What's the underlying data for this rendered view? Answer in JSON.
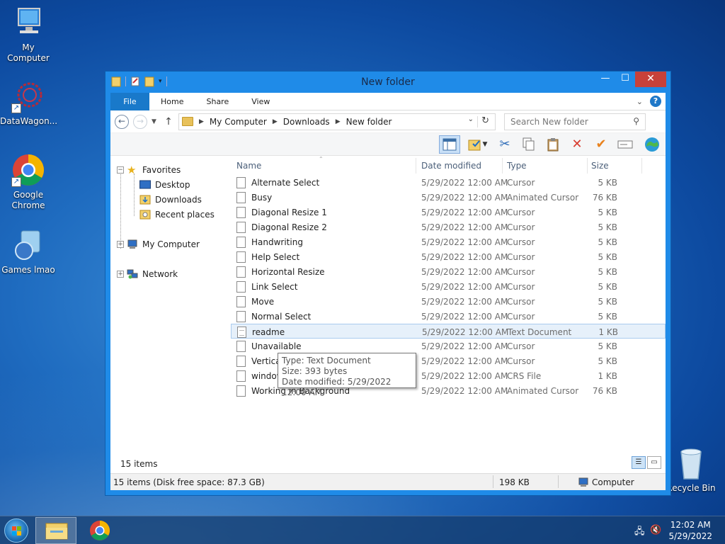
{
  "desktop": {
    "icons": [
      {
        "label": "My Computer"
      },
      {
        "label": "DataWagon..."
      },
      {
        "label": "Google Chrome"
      },
      {
        "label": "Games lmao"
      },
      {
        "label": "Recycle Bin"
      }
    ]
  },
  "window": {
    "title": "New folder",
    "controls": {
      "minimize": "—",
      "maximize": "☐",
      "close": "✕"
    }
  },
  "ribbon": {
    "tabs": [
      "File",
      "Home",
      "Share",
      "View"
    ],
    "help": "?"
  },
  "address": {
    "crumbs": [
      "My Computer",
      "Downloads",
      "New folder"
    ],
    "search_placeholder": "Search New folder"
  },
  "nav": {
    "favorites": "Favorites",
    "desktop": "Desktop",
    "downloads": "Downloads",
    "recent": "Recent places",
    "my_computer": "My Computer",
    "network": "Network"
  },
  "columns": {
    "name": "Name",
    "date": "Date modified",
    "type": "Type",
    "size": "Size"
  },
  "files": [
    {
      "name": "Alternate Select",
      "date": "5/29/2022 12:00 AM",
      "type": "Cursor",
      "size": "5 KB"
    },
    {
      "name": "Busy",
      "date": "5/29/2022 12:00 AM",
      "type": "Animated Cursor",
      "size": "76 KB"
    },
    {
      "name": "Diagonal Resize 1",
      "date": "5/29/2022 12:00 AM",
      "type": "Cursor",
      "size": "5 KB"
    },
    {
      "name": "Diagonal Resize 2",
      "date": "5/29/2022 12:00 AM",
      "type": "Cursor",
      "size": "5 KB"
    },
    {
      "name": "Handwriting",
      "date": "5/29/2022 12:00 AM",
      "type": "Cursor",
      "size": "5 KB"
    },
    {
      "name": "Help Select",
      "date": "5/29/2022 12:00 AM",
      "type": "Cursor",
      "size": "5 KB"
    },
    {
      "name": "Horizontal Resize",
      "date": "5/29/2022 12:00 AM",
      "type": "Cursor",
      "size": "5 KB"
    },
    {
      "name": "Link Select",
      "date": "5/29/2022 12:00 AM",
      "type": "Cursor",
      "size": "5 KB"
    },
    {
      "name": "Move",
      "date": "5/29/2022 12:00 AM",
      "type": "Cursor",
      "size": "5 KB"
    },
    {
      "name": "Normal Select",
      "date": "5/29/2022 12:00 AM",
      "type": "Cursor",
      "size": "5 KB"
    },
    {
      "name": "readme",
      "date": "5/29/2022 12:00 AM",
      "type": "Text Document",
      "size": "1 KB"
    },
    {
      "name": "Unavailable",
      "date": "5/29/2022 12:00 AM",
      "type": "Cursor",
      "size": "5 KB"
    },
    {
      "name": "Vertical",
      "date": "5/29/2022 12:00 AM",
      "type": "Cursor",
      "size": "5 KB"
    },
    {
      "name": "window",
      "date": "5/29/2022 12:00 AM",
      "type": "CRS File",
      "size": "1 KB"
    },
    {
      "name": "Working in Background",
      "date": "5/29/2022 12:00 AM",
      "type": "Animated Cursor",
      "size": "76 KB"
    }
  ],
  "tooltip": {
    "type": "Type: Text Document",
    "size": "Size: 393 bytes",
    "date": "Date modified: 5/29/2022 12:00 AM"
  },
  "footer": {
    "count": "15 items"
  },
  "status": {
    "disk": "15 items (Disk free space: 87.3 GB)",
    "size": "198 KB",
    "location": "Computer"
  },
  "taskbar": {
    "time": "12:02 AM",
    "date": "5/29/2022"
  }
}
